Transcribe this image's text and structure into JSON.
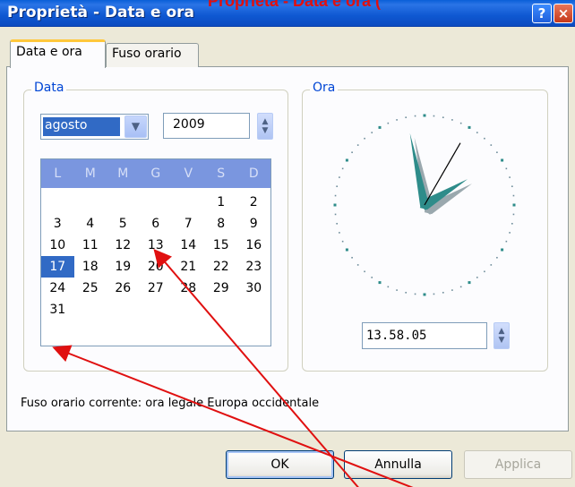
{
  "window": {
    "title": "Proprietà - Data e ora",
    "title_overlay": "Proprietà - Data e ora (",
    "help_symbol": "?",
    "close_symbol": "×"
  },
  "tabs": [
    {
      "label": "Data e ora",
      "active": true
    },
    {
      "label": "Fuso orario",
      "active": false
    }
  ],
  "date_group": {
    "legend": "Data",
    "month_value": "agosto",
    "year_value": "2009",
    "weekday_headers": [
      "L",
      "M",
      "M",
      "G",
      "V",
      "S",
      "D"
    ],
    "weeks": [
      [
        "",
        "",
        "",
        "",
        "",
        "1",
        "2"
      ],
      [
        "3",
        "4",
        "5",
        "6",
        "7",
        "8",
        "9"
      ],
      [
        "10",
        "11",
        "12",
        "13",
        "14",
        "15",
        "16"
      ],
      [
        "17",
        "18",
        "19",
        "20",
        "21",
        "22",
        "23"
      ],
      [
        "24",
        "25",
        "26",
        "27",
        "28",
        "29",
        "30"
      ],
      [
        "31",
        "",
        "",
        "",
        "",
        "",
        ""
      ]
    ],
    "selected_day": "17"
  },
  "time_group": {
    "legend": "Ora",
    "time_value": "13.58.05",
    "clock": {
      "hours": 13,
      "minutes": 58,
      "seconds": 5
    }
  },
  "timezone": {
    "text": "Fuso orario corrente:  ora legale Europa occidentale"
  },
  "buttons": {
    "ok": "OK",
    "cancel": "Annulla",
    "apply": "Applica"
  },
  "colors": {
    "accent": "#316AC5",
    "annotation": "#E01010",
    "clock_hand": "#2E8C8A",
    "legend": "#0046D5"
  },
  "icons": {
    "dropdown": "chevron-down-icon",
    "spinner": "spin-up-down-icon"
  }
}
